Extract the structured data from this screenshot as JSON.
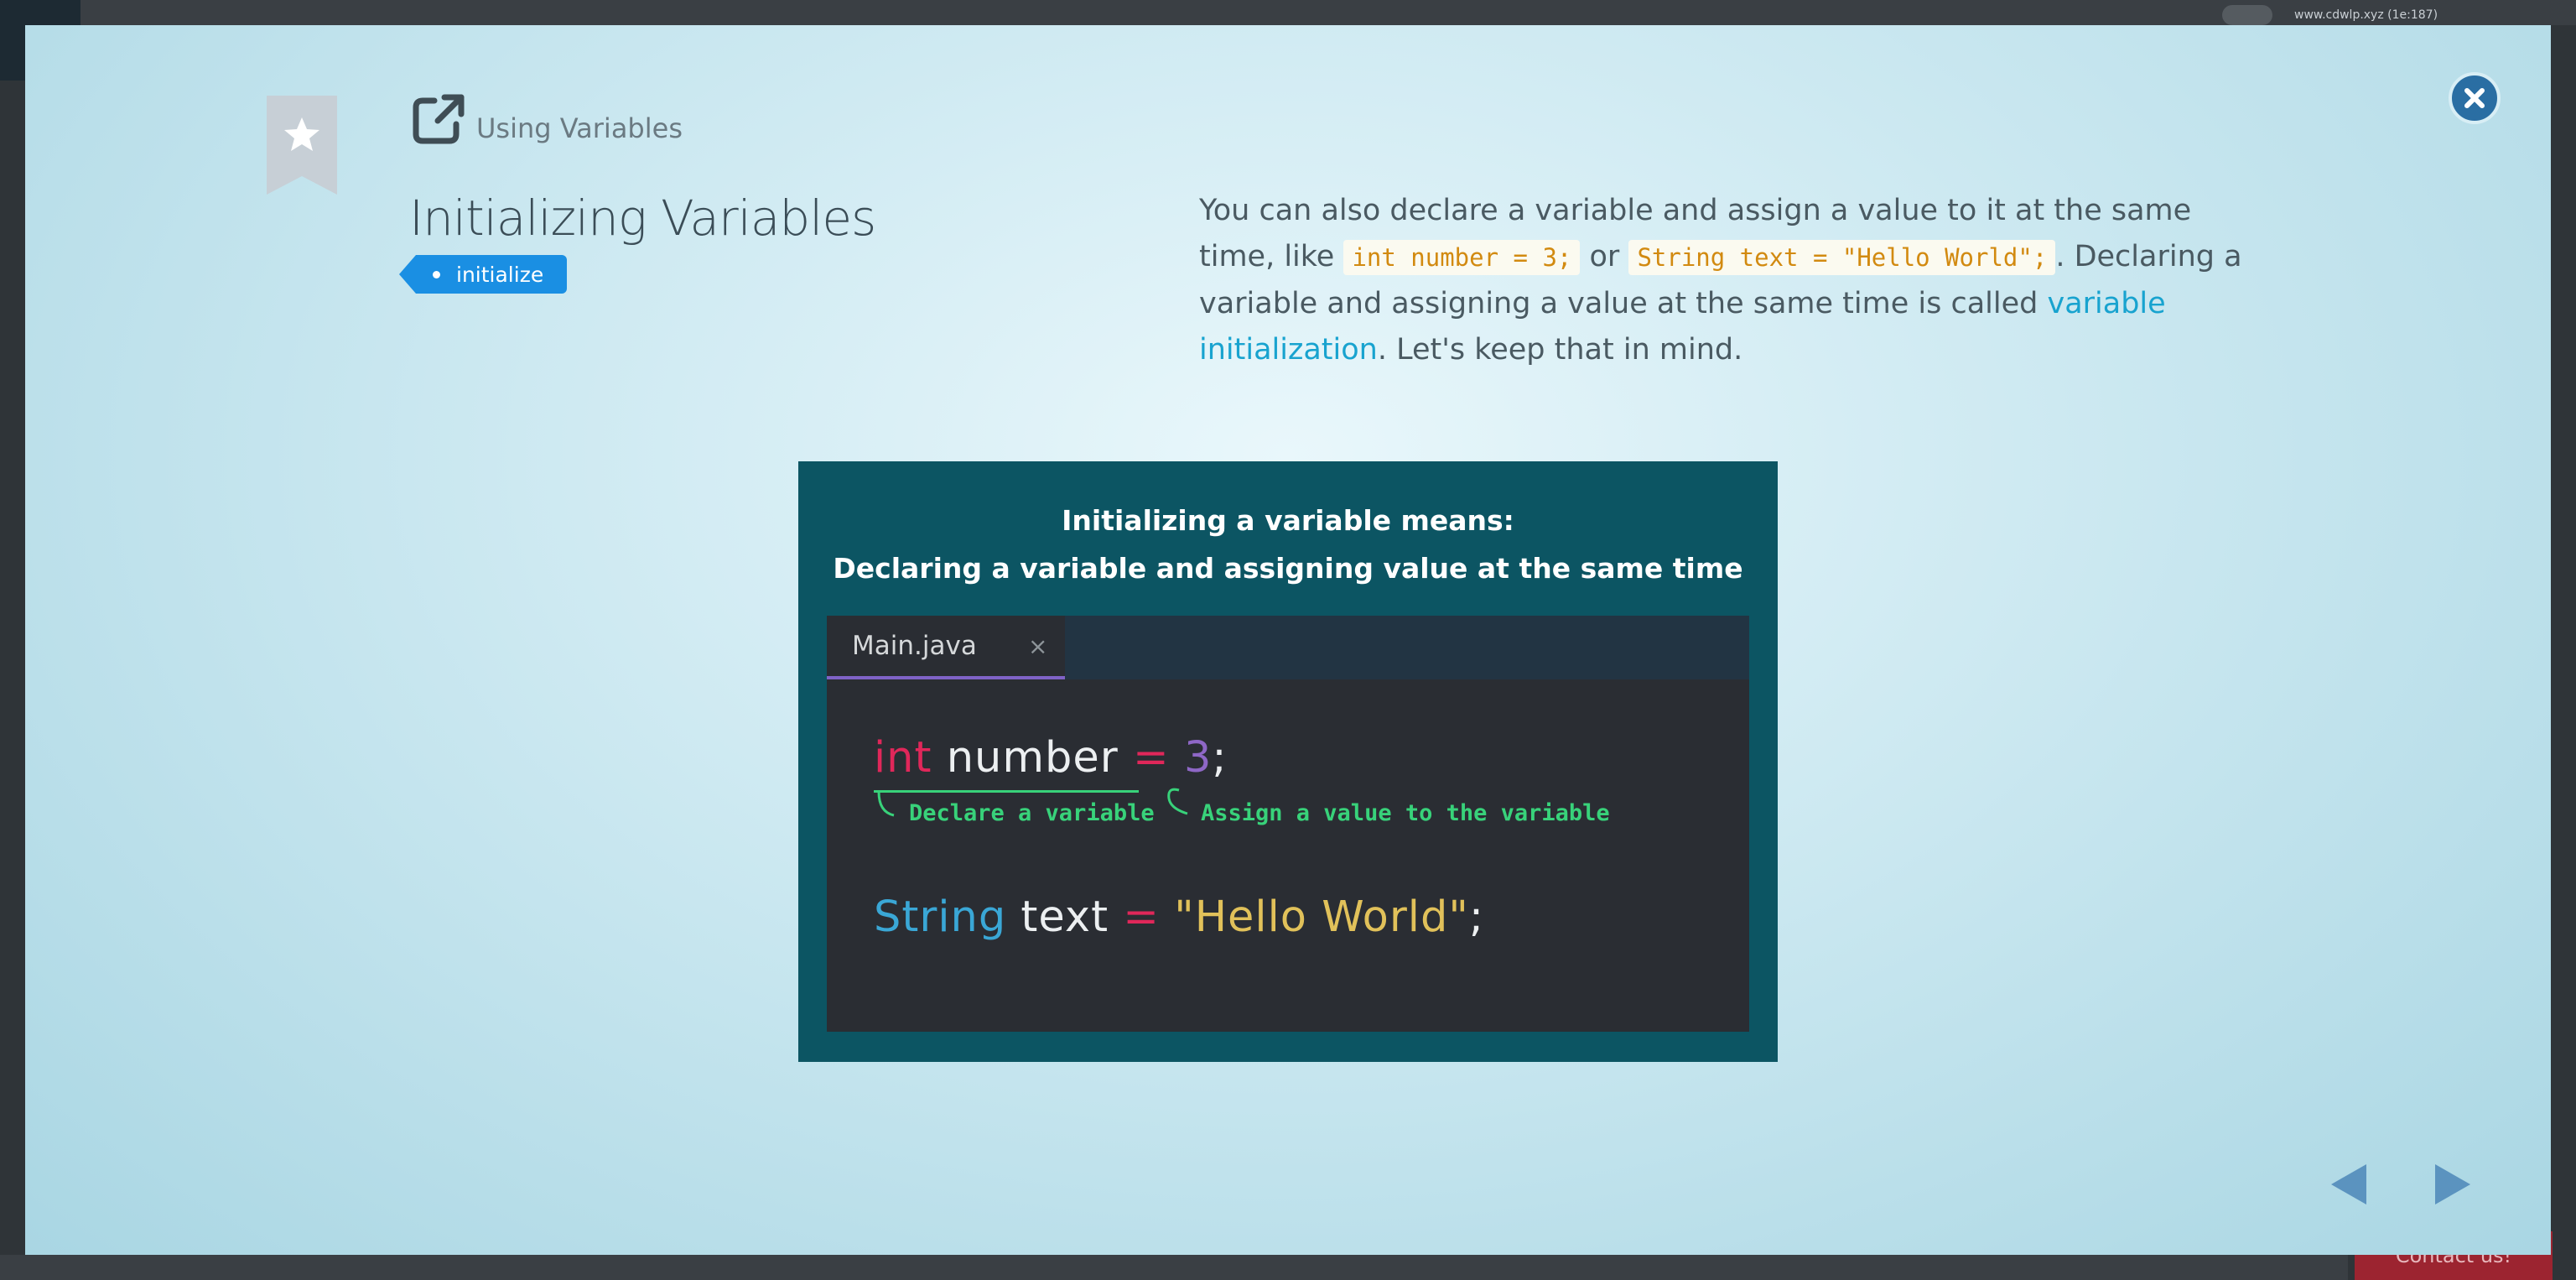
{
  "background": {
    "url_text": "www.cdwlp.xyz (1e:187)",
    "contact_label": "Contact us!"
  },
  "header": {
    "breadcrumb": "Using Variables",
    "title": "Initializing Variables",
    "tag": "initialize"
  },
  "description": {
    "p1_before": "You can also declare a variable and assign a value to it at the same time, like ",
    "code1": "int number = 3;",
    "p1_mid": " or ",
    "code2": "String text = \"Hello World\";",
    "p1_after": ". Declaring a variable and assigning a value at the same time is called ",
    "link": "variable initialization",
    "p1_end": ". Let's keep that in mind."
  },
  "figure": {
    "caption_line1": "Initializing a variable means:",
    "caption_line2": "Declaring a variable and assigning value at the same time",
    "tab_name": "Main.java",
    "tab_close": "×",
    "line1": {
      "type": "int",
      "name": "number",
      "op": "=",
      "value": "3",
      "end": ";"
    },
    "annot_declare": "Declare a variable",
    "annot_assign": "Assign a value to the variable",
    "line2": {
      "type": "String",
      "name": "text",
      "op": "=",
      "value": "\"Hello World\"",
      "end": ";"
    }
  },
  "colors": {
    "accent_blue": "#1a8fe3",
    "link": "#18a3cf",
    "figure_bg": "#0c5563",
    "editor_bg": "#2a2d33",
    "annotation_green": "#38d27a"
  },
  "icons": {
    "close": "close-icon",
    "bookmark": "bookmark-star-icon",
    "external": "external-link-icon",
    "prev": "arrow-left-icon",
    "next": "arrow-right-icon"
  }
}
